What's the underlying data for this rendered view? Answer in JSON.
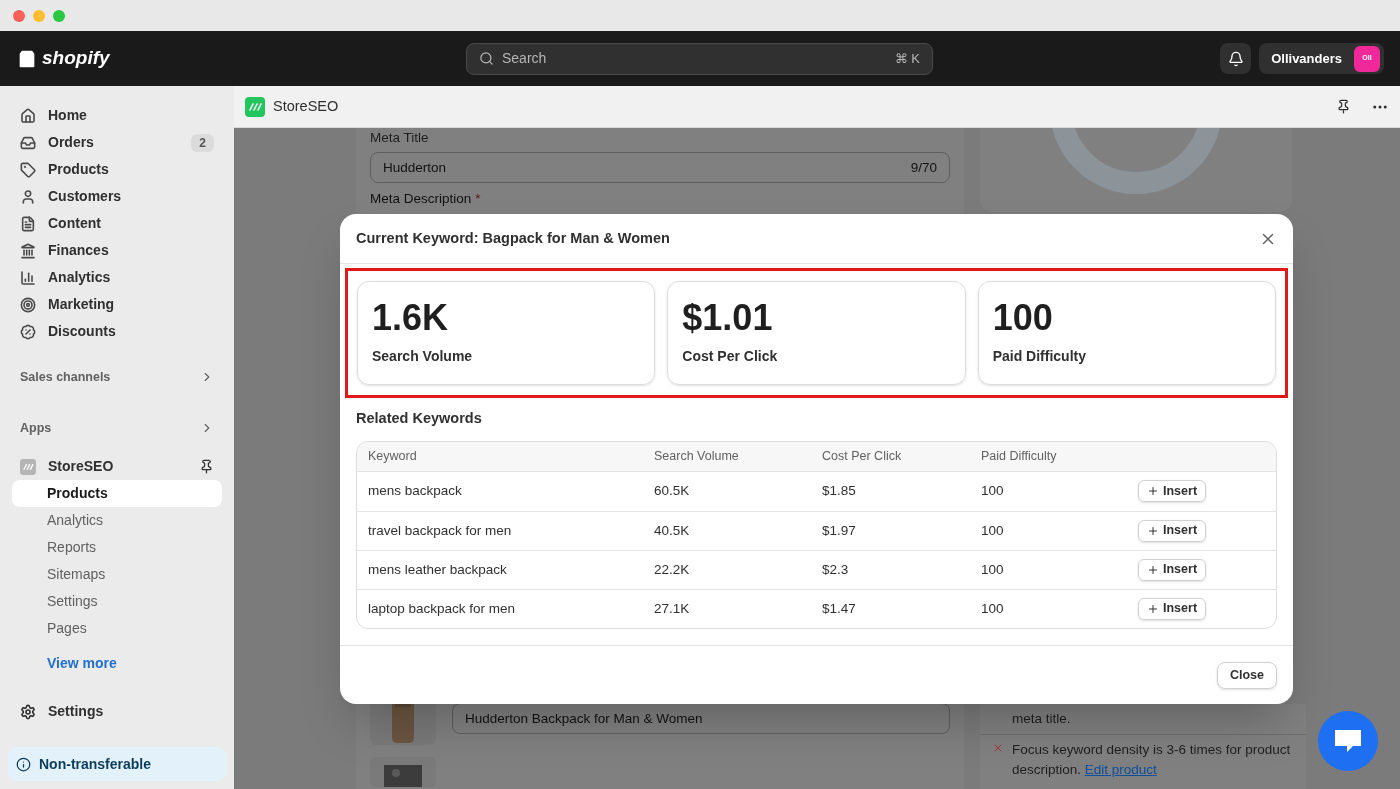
{
  "topbar": {
    "brand": "shopify",
    "search": {
      "placeholder": "Search",
      "shortcut": "⌘ K"
    },
    "store": {
      "name": "Ollivanders",
      "initials": "Oll"
    }
  },
  "sidebar": {
    "items": [
      {
        "label": "Home",
        "selected": false
      },
      {
        "label": "Orders",
        "selected": false,
        "badge": "2"
      },
      {
        "label": "Products",
        "selected": false
      },
      {
        "label": "Customers",
        "selected": false
      },
      {
        "label": "Content",
        "selected": false
      },
      {
        "label": "Finances",
        "selected": false
      },
      {
        "label": "Analytics",
        "selected": false
      },
      {
        "label": "Marketing",
        "selected": false
      },
      {
        "label": "Discounts",
        "selected": false
      }
    ],
    "sales_channels": "Sales channels",
    "apps": "Apps",
    "app": {
      "name": "StoreSEO",
      "children": [
        {
          "label": "Products",
          "selected": true
        },
        {
          "label": "Analytics",
          "selected": false
        },
        {
          "label": "Reports",
          "selected": false
        },
        {
          "label": "Sitemaps",
          "selected": false
        },
        {
          "label": "Settings",
          "selected": false
        },
        {
          "label": "Pages",
          "selected": false
        }
      ],
      "view_more": "View more"
    },
    "settings": "Settings",
    "notice": "Non-transferable"
  },
  "app_header": {
    "title": "StoreSEO"
  },
  "background": {
    "meta_title": {
      "label": "Meta Title",
      "value": "Hudderton",
      "counter": "9/70"
    },
    "meta_description": {
      "label": "Meta Description",
      "required_mark": "*"
    },
    "product_title": {
      "value": "Hudderton Backpack for Man & Women"
    },
    "checks": [
      {
        "text": "meta title."
      },
      {
        "text": "Focus keyword density is 3-6 times for product description.",
        "passed": false,
        "link": "Edit product"
      }
    ]
  },
  "modal": {
    "title": "Current Keyword: Bagpack for Man & Women",
    "stats": [
      {
        "value": "1.6K",
        "label": "Search Volume"
      },
      {
        "value": "$1.01",
        "label": "Cost Per Click"
      },
      {
        "value": "100",
        "label": "Paid Difficulty"
      }
    ],
    "related_title": "Related Keywords",
    "table": {
      "columns": [
        "Keyword",
        "Search Volume",
        "Cost Per Click",
        "Paid Difficulty"
      ],
      "rows": [
        {
          "cells": [
            "mens backpack",
            "60.5K",
            "$1.85",
            "100"
          ],
          "action": "Insert"
        },
        {
          "cells": [
            "travel backpack for men",
            "40.5K",
            "$1.97",
            "100"
          ],
          "action": "Insert"
        },
        {
          "cells": [
            "mens leather backpack",
            "22.2K",
            "$2.3",
            "100"
          ],
          "action": "Insert"
        },
        {
          "cells": [
            "laptop backpack for men",
            "27.1K",
            "$1.47",
            "100"
          ],
          "action": "Insert"
        }
      ]
    },
    "close_button": "Close"
  }
}
